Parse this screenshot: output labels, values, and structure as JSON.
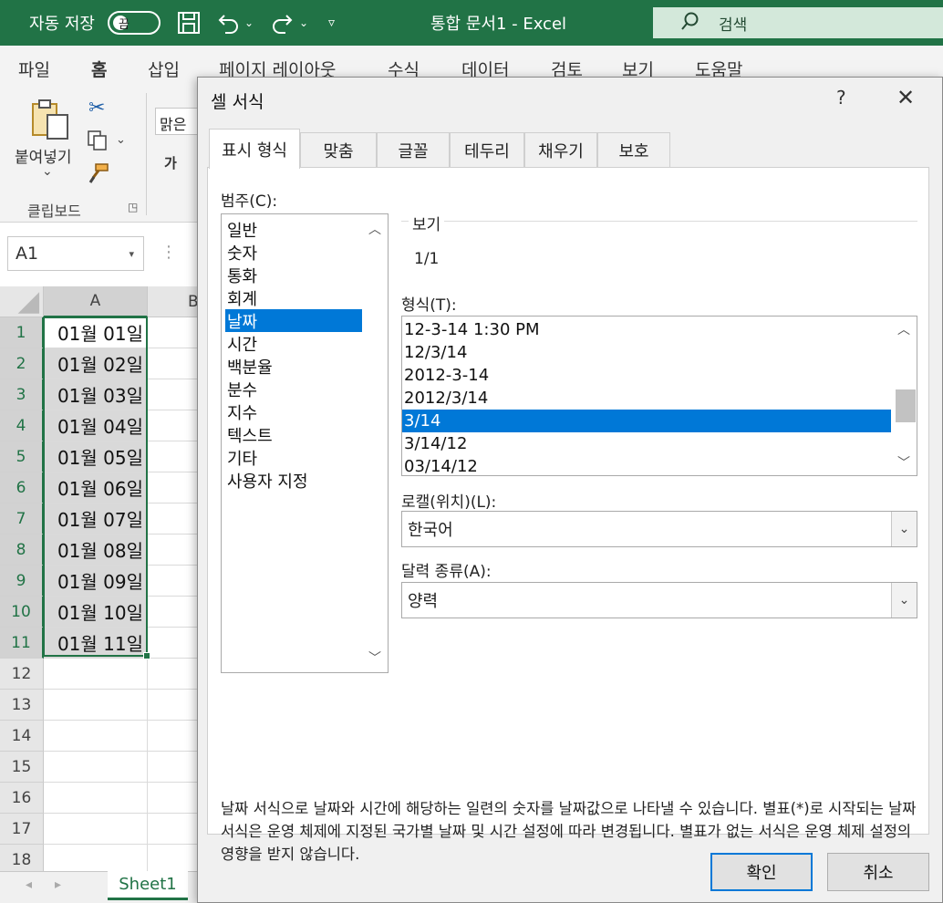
{
  "titlebar": {
    "autosave_label": "자동 저장",
    "autosave_state": "끔",
    "title": "통합 문서1  -  Excel",
    "search_placeholder": "검색"
  },
  "ribbon": {
    "tabs": [
      "파일",
      "홈",
      "삽입",
      "페이지 레이아웃",
      "수식",
      "데이터",
      "검토",
      "보기",
      "도움말"
    ],
    "active_tab": "홈",
    "paste_label": "붙여넣기",
    "clipboard_group": "클립보드",
    "font_name": "맑은",
    "bold_hint": "가"
  },
  "sheet": {
    "name_box": "A1",
    "col_a": "A",
    "col_b": "B",
    "rows": [
      "1",
      "2",
      "3",
      "4",
      "5",
      "6",
      "7",
      "8",
      "9",
      "10",
      "11",
      "12",
      "13",
      "14",
      "15",
      "16",
      "17",
      "18"
    ],
    "cells": [
      "01월 01일",
      "01월 02일",
      "01월 03일",
      "01월 04일",
      "01월 05일",
      "01월 06일",
      "01월 07일",
      "01월 08일",
      "01월 09일",
      "01월 10일",
      "01월 11일"
    ],
    "sheet_tab": "Sheet1"
  },
  "dialog": {
    "title": "셀 서식",
    "help": "?",
    "close": "✕",
    "tabs": [
      "표시 형식",
      "맞춤",
      "글꼴",
      "테두리",
      "채우기",
      "보호"
    ],
    "active_tab": "표시 형식",
    "category_label": "범주(C):",
    "categories": [
      "일반",
      "숫자",
      "통화",
      "회계",
      "날짜",
      "시간",
      "백분율",
      "분수",
      "지수",
      "텍스트",
      "기타",
      "사용자 지정"
    ],
    "selected_category": "날짜",
    "sample_label": "보기",
    "sample_value": "1/1",
    "type_label": "형식(T):",
    "types": [
      "12-3-14 1:30 PM",
      "12/3/14",
      "2012-3-14",
      "2012/3/14",
      "3/14",
      "3/14/12",
      "03/14/12"
    ],
    "selected_type": "3/14",
    "locale_label": "로캘(위치)(L):",
    "locale_value": "한국어",
    "calendar_label": "달력 종류(A):",
    "calendar_value": "양력",
    "description": "날짜 서식으로 날짜와 시간에 해당하는 일련의 숫자를 날짜값으로 나타낼 수 있습니다. 별표(*)로 시작되는 날짜 서식은 운영 체제에 지정된 국가별 날짜 및 시간 설정에 따라 변경됩니다. 별표가 없는 서식은 운영 체제 설정의 영향을 받지 않습니다.",
    "ok_label": "확인",
    "cancel_label": "취소"
  }
}
